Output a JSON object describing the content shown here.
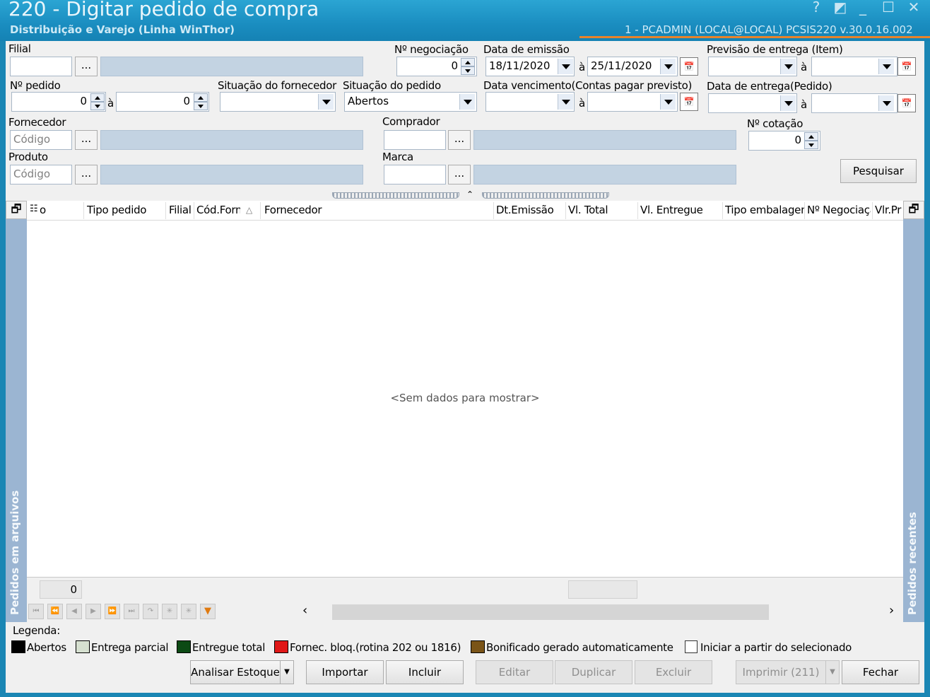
{
  "window": {
    "title": "220 - Digitar pedido de compra",
    "subtitle": "Distribuição e Varejo (Linha WinThor)",
    "user_info": "1 - PCADMIN (LOCAL@LOCAL)   PCSIS220  v.30.0.16.002"
  },
  "form": {
    "filial_label": "Filial",
    "negociacao_label": "Nº negociação",
    "negociacao_value": "0",
    "emissao_label": "Data de emissão",
    "emissao_from": "18/11/2020",
    "emissao_to": "25/11/2020",
    "previsao_label": "Previsão  de entrega (Item)",
    "pedido_label": "Nº pedido",
    "pedido_from": "0",
    "pedido_to": "0",
    "sit_fornecedor_label": "Situação do fornecedor",
    "sit_pedido_label": "Situação do pedido",
    "sit_pedido_value": "Abertos",
    "vencimento_label": "Data vencimento(Contas pagar previsto)",
    "entrega_pedido_label": "Data de entrega(Pedido)",
    "fornecedor_label": "Fornecedor",
    "fornecedor_placeholder": "Código",
    "comprador_label": "Comprador",
    "cotacao_label": "Nº cotação",
    "cotacao_value": "0",
    "produto_label": "Produto",
    "produto_placeholder": "Código",
    "marca_label": "Marca",
    "range_sep": "à",
    "ellipsis": "...",
    "pesquisar_label": "Pesquisar"
  },
  "grid": {
    "columns": [
      "Tipo pedido",
      "Filial",
      "Cód.Forn",
      "Fornecedor",
      "Dt.Emissão",
      "Vl. Total",
      "Vl. Entregue",
      "Tipo embalagem",
      "Nº Negociação",
      "Vlr.Pr"
    ],
    "first_col_fragment": "o",
    "no_data": "<Sem dados para mostrar>",
    "footer_count": "0",
    "left_panel": "Pedidos em arquivos",
    "right_panel": "Pedidos recentes"
  },
  "legend": {
    "title": "Legenda:",
    "items": [
      {
        "label": "Abertos",
        "color": "#000000"
      },
      {
        "label": "Entrega parcial",
        "color": "#d6e0d0"
      },
      {
        "label": "Entregue total",
        "color": "#0c4a14"
      },
      {
        "label": "Fornec. bloq.(rotina 202 ou 1816)",
        "color": "#e01818"
      },
      {
        "label": "Bonificado gerado automaticamente",
        "color": "#7a5418"
      }
    ],
    "iniciar_label": "Iniciar a partir do selecionado"
  },
  "buttons": {
    "analisar": "Analisar Estoque",
    "importar": "Importar",
    "incluir": "Incluir",
    "editar": "Editar",
    "duplicar": "Duplicar",
    "excluir": "Excluir",
    "imprimir": "Imprimir (211)",
    "fechar": "Fechar"
  }
}
